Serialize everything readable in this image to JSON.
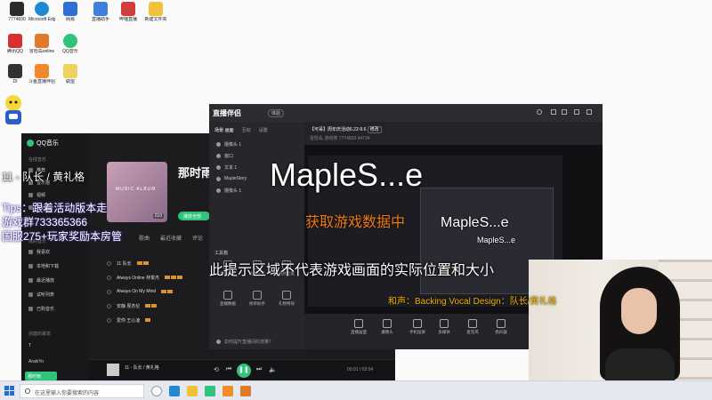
{
  "desktop": {
    "icons": [
      {
        "label": "7774830",
        "color": "#2b2b2b"
      },
      {
        "label": "Microsoft Edge",
        "color": "#1f8ad1"
      },
      {
        "label": "网易",
        "color": "#2f6fd6"
      },
      {
        "label": "直播助手",
        "color": "#3f7fe0"
      },
      {
        "label": "哔哩直播",
        "color": "#d23d3d"
      },
      {
        "label": "新建文件夹",
        "color": "#f0c23a"
      },
      {
        "label": "腾讯QQ",
        "color": "#d43131"
      },
      {
        "label": "冒险岛online",
        "color": "#e07a2a"
      },
      {
        "label": "QQ音乐",
        "color": "#31c27c"
      },
      {
        "label": "DI",
        "color": "#333333"
      },
      {
        "label": "斗鱼直播伴侣",
        "color": "#f08a2a"
      },
      {
        "label": "联盟",
        "color": "#f0d060"
      }
    ]
  },
  "overlays": {
    "song_line": "11 - 队长 / 黄礼格",
    "tips": "Tips：跟着活动版本走",
    "group": "游戏群733365366",
    "server": "国服275+玩家奖励本房管",
    "watermark_big": "MapleS...e",
    "watermark_mid": "MapleS...e",
    "watermark_small": "MapleS...e",
    "orange_text": "获取游戏数据中",
    "notice": "此提示区域不代表游戏画面的实际位置和大小",
    "credit": "和声：Backing Vocal Design：队长/黄礼格"
  },
  "music_app": {
    "logo": "QQ音乐",
    "section_online": "在线音乐",
    "nav_items": [
      "推荐",
      "音乐馆",
      "视频",
      "电台"
    ],
    "section_mine": "我的音乐",
    "my_items": [
      "我喜欢",
      "本地和下载",
      "最近播放",
      "试听列表",
      "已购音乐"
    ],
    "section_created": "创建的歌单",
    "created_items": [
      "T",
      "ArakiYo"
    ],
    "selected_item": "那时雨",
    "album_label": "MUSIC ALBUM",
    "album_count": "210",
    "title": "那时雨",
    "play_button": "播放全部",
    "tabs": [
      "歌曲",
      "最近收藏",
      "评论"
    ],
    "songs": [
      "11 队长",
      "Always Online 林俊杰",
      "Always On My Mind",
      "安静 周杰伦",
      "爱你 王心凌"
    ],
    "now_playing": "11 - 队长 / 黄礼格",
    "time": "00:01 / 03:54"
  },
  "stream_app": {
    "brand": "直播伴侣",
    "badge": "体验",
    "left_tabs": [
      "场景·画面",
      "互动",
      "设置"
    ],
    "scenes": [
      "摄像头 1",
      "窗口",
      "文本 1",
      "MapleStory",
      "摄像头 1"
    ],
    "tools_title": "工具箱",
    "tools": [
      "弹幕助手",
      "主播任务",
      "视频连麦",
      "直播数据",
      "榜单助手",
      "礼物特效"
    ],
    "notice_line": "如何提升直播间的流量？",
    "room_title": "【可哥】周年庆活动6.22-9.6",
    "room_tag": "修改",
    "room_meta": "冒险岛  游戏类  7774830  44734",
    "bottom_buttons": [
      "直播画面",
      "摄像头",
      "手机投屏",
      "多媒体",
      "麦克风",
      "扬声器"
    ]
  },
  "taskbar": {
    "search_placeholder": "在这里输入你要搜索的内容"
  }
}
